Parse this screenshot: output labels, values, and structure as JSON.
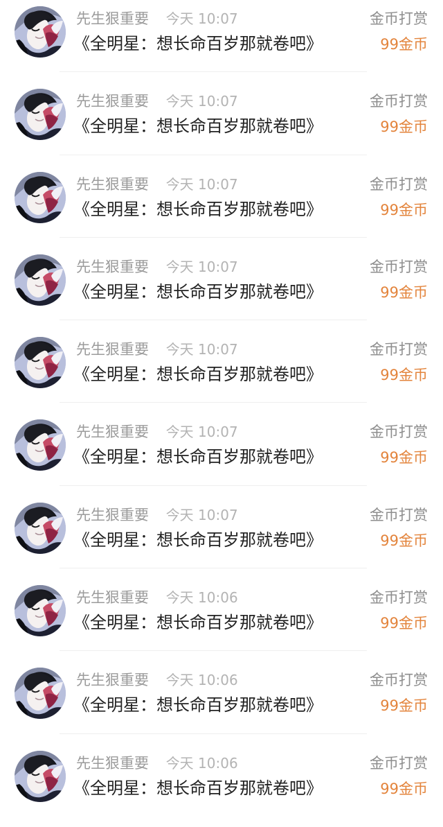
{
  "reward_list": {
    "items": [
      {
        "user": "先生狠重要",
        "time": "今天 10:07",
        "book": "《全明星：想长命百岁那就卷吧》",
        "gift_type": "金币打赏",
        "amount": "99金币",
        "avatar": "avatar-portrait"
      },
      {
        "user": "先生狠重要",
        "time": "今天 10:07",
        "book": "《全明星：想长命百岁那就卷吧》",
        "gift_type": "金币打赏",
        "amount": "99金币",
        "avatar": "avatar-portrait"
      },
      {
        "user": "先生狠重要",
        "time": "今天 10:07",
        "book": "《全明星：想长命百岁那就卷吧》",
        "gift_type": "金币打赏",
        "amount": "99金币",
        "avatar": "avatar-portrait"
      },
      {
        "user": "先生狠重要",
        "time": "今天 10:07",
        "book": "《全明星：想长命百岁那就卷吧》",
        "gift_type": "金币打赏",
        "amount": "99金币",
        "avatar": "avatar-portrait"
      },
      {
        "user": "先生狠重要",
        "time": "今天 10:07",
        "book": "《全明星：想长命百岁那就卷吧》",
        "gift_type": "金币打赏",
        "amount": "99金币",
        "avatar": "avatar-portrait"
      },
      {
        "user": "先生狠重要",
        "time": "今天 10:07",
        "book": "《全明星：想长命百岁那就卷吧》",
        "gift_type": "金币打赏",
        "amount": "99金币",
        "avatar": "avatar-portrait"
      },
      {
        "user": "先生狠重要",
        "time": "今天 10:07",
        "book": "《全明星：想长命百岁那就卷吧》",
        "gift_type": "金币打赏",
        "amount": "99金币",
        "avatar": "avatar-portrait"
      },
      {
        "user": "先生狠重要",
        "time": "今天 10:06",
        "book": "《全明星：想长命百岁那就卷吧》",
        "gift_type": "金币打赏",
        "amount": "99金币",
        "avatar": "avatar-portrait"
      },
      {
        "user": "先生狠重要",
        "time": "今天 10:06",
        "book": "《全明星：想长命百岁那就卷吧》",
        "gift_type": "金币打赏",
        "amount": "99金币",
        "avatar": "avatar-portrait"
      },
      {
        "user": "先生狠重要",
        "time": "今天 10:06",
        "book": "《全明星：想长命百岁那就卷吧》",
        "gift_type": "金币打赏",
        "amount": "99金币",
        "avatar": "avatar-portrait"
      }
    ]
  },
  "colors": {
    "background": "#ffffff",
    "username": "#9b9b9b",
    "time": "#b3b3b3",
    "title": "#222222",
    "gift_type": "#8e8e8e",
    "amount": "#e3843c",
    "divider": "#efefef"
  }
}
